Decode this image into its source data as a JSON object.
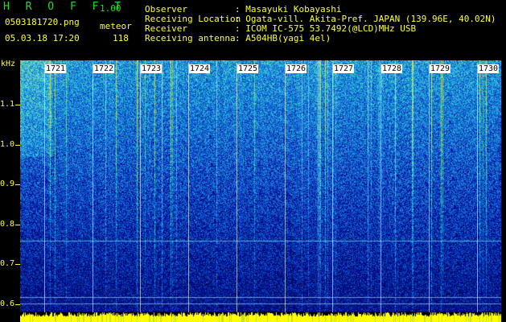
{
  "header": {
    "app_title": "H R O F F T",
    "version": "1.00",
    "filename": "0503181720.png",
    "category_label": "meteor",
    "timestamp": "05.03.18 17:20",
    "count": "118",
    "fields": [
      {
        "label": "Observer",
        "value": ": Masayuki Kobayashi"
      },
      {
        "label": "Receiving Location",
        "value": ": Ogata-vill. Akita-Pref. JAPAN (139.96E, 40.02N)"
      },
      {
        "label": "Receiver",
        "value": ": ICOM IC-575 53.7492(@LCD)MHz USB"
      },
      {
        "label": "Receiving antenna",
        "value": ": A504HB(yagi 4el)"
      }
    ]
  },
  "axis": {
    "y_unit": "kHz",
    "y_ticks": [
      "1.1",
      "1.0",
      "0.9",
      "0.8",
      "0.7",
      "0.6"
    ],
    "x_ticks": [
      "1721",
      "1722",
      "1723",
      "1724",
      "1725",
      "1726",
      "1727",
      "1728",
      "1729",
      "1730"
    ]
  },
  "colors": {
    "background": "#000000",
    "header_green": "#1fe01f",
    "header_yellow": "#ffff33",
    "noise_low": "#0a1a8c",
    "noise_high": "#3fd2ff"
  }
}
